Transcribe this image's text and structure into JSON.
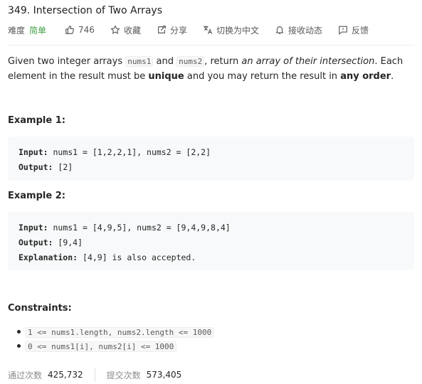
{
  "problem": {
    "title": "349. Intersection of Two Arrays",
    "difficulty_label": "难度",
    "difficulty_value": "简单",
    "likes": "746",
    "favorite_label": "收藏",
    "share_label": "分享",
    "translate_label": "切换为中文",
    "subscribe_label": "接收动态",
    "feedback_label": "反馈",
    "difficulty_color": "#43a047"
  },
  "description": {
    "part1": "Given two integer arrays ",
    "code1": "nums1",
    "part2": " and ",
    "code2": "nums2",
    "part3": ", return ",
    "em1": "an array of their intersection",
    "part4": ". Each element in the result must be ",
    "bold1": "unique",
    "part5": " and you may return the result in ",
    "bold2": "any order",
    "part6": "."
  },
  "examples": [
    {
      "title": "Example 1:",
      "input_label": "Input:",
      "input_value": " nums1 = [1,2,2,1], nums2 = [2,2]",
      "output_label": "Output:",
      "output_value": " [2]"
    },
    {
      "title": "Example 2:",
      "input_label": "Input:",
      "input_value": " nums1 = [4,9,5], nums2 = [9,4,9,8,4]",
      "output_label": "Output:",
      "output_value": " [9,4]",
      "explanation_label": "Explanation:",
      "explanation_value": " [4,9] is also accepted."
    }
  ],
  "constraints": {
    "title": "Constraints:",
    "items": [
      "1 <= nums1.length, nums2.length <= 1000",
      "0 <= nums1[i], nums2[i] <= 1000"
    ]
  },
  "stats": {
    "accepted_label": "通过次数",
    "accepted_value": "425,732",
    "submissions_label": "提交次数",
    "submissions_value": "573,405"
  },
  "icons": {
    "like": "thumb-up-icon",
    "favorite": "star-icon",
    "share": "share-icon",
    "translate": "translate-icon",
    "subscribe": "bell-icon",
    "feedback": "feedback-icon"
  }
}
